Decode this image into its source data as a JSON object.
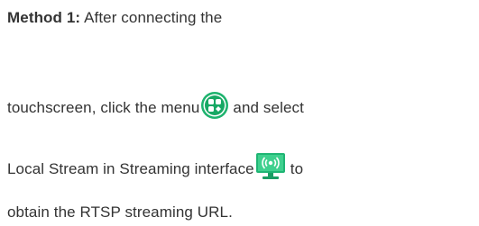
{
  "method": {
    "label": "Method 1:",
    "line1_text": "After connecting the",
    "line2_before_icon": "touchscreen, click the menu",
    "line2_after_icon": "and select",
    "line3_before_icon": "Local Stream in Streaming interface",
    "line3_after_icon": "to",
    "line4_text": "obtain the RTSP streaming URL."
  },
  "icons": {
    "menu": "menu-grid-icon",
    "streaming": "streaming-monitor-icon"
  },
  "colors": {
    "text": "#333333",
    "icon_green": "#17b06b",
    "icon_dark_green": "#0d8a52"
  }
}
